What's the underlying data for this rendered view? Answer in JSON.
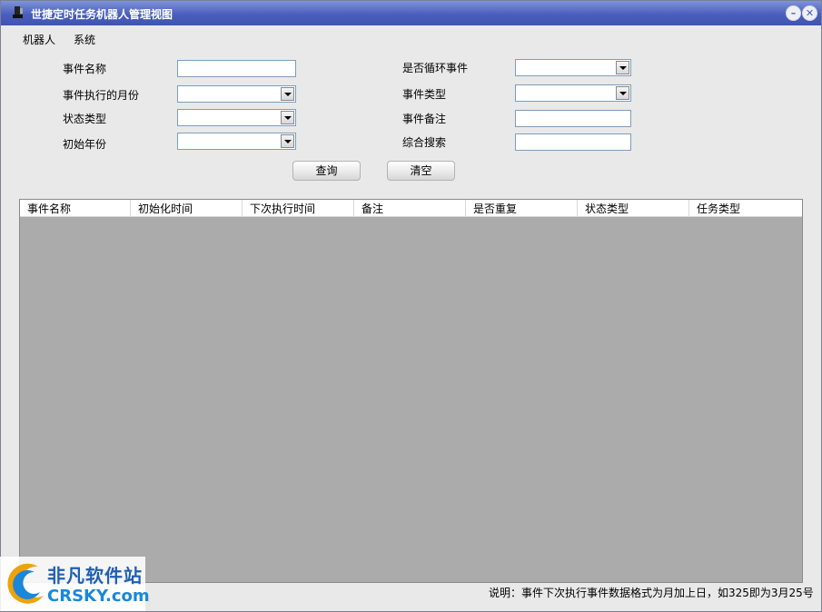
{
  "window": {
    "title": "世捷定时任务机器人管理视图"
  },
  "menu": {
    "items": [
      "机器人",
      "系统"
    ]
  },
  "form": {
    "event_name_label": "事件名称",
    "event_name_value": "",
    "exec_month_label": "事件执行的月份",
    "exec_month_value": "",
    "status_type_label": "状态类型",
    "status_type_value": "",
    "start_year_label": "初始年份",
    "start_year_value": "",
    "is_loop_label": "是否循环事件",
    "is_loop_value": "",
    "event_type_label": "事件类型",
    "event_type_value": "",
    "event_note_label": "事件备注",
    "event_note_value": "",
    "search_label": "综合搜索",
    "search_value": "",
    "query_button": "查询",
    "clear_button": "清空"
  },
  "grid": {
    "columns": [
      "事件名称",
      "初始化时间",
      "下次执行时间",
      "备注",
      "是否重复",
      "状态类型",
      "任务类型"
    ],
    "rows": []
  },
  "status": {
    "text": "说明：事件下次执行事件数据格式为月加上日，如325即为3月25号"
  },
  "watermark": {
    "cn": "非凡软件站",
    "en": "CRSKY.com"
  },
  "colors": {
    "titlebar": "#4a5fbd",
    "grid_bg": "#ababab",
    "input_border": "#7f9db9"
  }
}
